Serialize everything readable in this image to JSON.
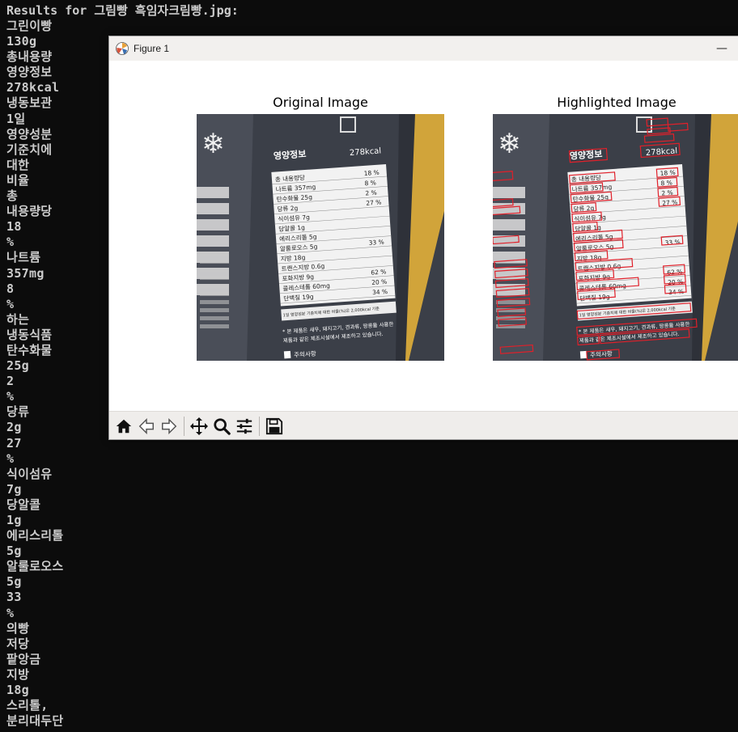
{
  "terminal": {
    "header": "Results for 그림빵 흑임자크림빵.jpg:",
    "lines": [
      "그린이빵",
      "130g",
      "총내용량",
      "영양정보",
      "278kcal",
      "냉동보관",
      "1일",
      "영양성분",
      "기준치에",
      "대한",
      "비율",
      "총",
      "내용량당",
      "18",
      "%",
      "나트륨",
      "357mg",
      "8",
      "%",
      "하는",
      "냉동식품",
      "탄수화물",
      "25g",
      "2",
      "%",
      "당류",
      "2g",
      "27",
      "%",
      "식이섬유",
      "7g",
      "당알콜",
      "1g",
      "에리스리톨",
      "5g",
      "알룰로오스",
      "5g",
      "33",
      "%",
      "의빵",
      "저당",
      "팥앙금",
      "지방",
      "18g",
      "스리톨,",
      "분리대두단"
    ]
  },
  "window": {
    "title": "Figure 1",
    "minimize_glyph": "—"
  },
  "plots": {
    "left_title": "Original Image",
    "right_title": "Highlighted Image"
  },
  "label_photo": {
    "header": "영양정보",
    "total": "278kcal",
    "rows": [
      {
        "name": "총 내용량당",
        "pct": "18 %"
      },
      {
        "name": "나트륨 357mg",
        "pct": "8 %"
      },
      {
        "name": "탄수화물 25g",
        "pct": "2 %"
      },
      {
        "name": "당류 2g",
        "pct": "27 %"
      },
      {
        "name": "식이섬유 7g",
        "pct": ""
      },
      {
        "name": "당알콜 1g",
        "pct": ""
      },
      {
        "name": "에리스리톨 5g",
        "pct": ""
      },
      {
        "name": "알룰로오스 5g",
        "pct": "33 %"
      },
      {
        "name": "지방 18g",
        "pct": ""
      },
      {
        "name": "트랜스지방 0.6g",
        "pct": ""
      },
      {
        "name": "포화지방 9g",
        "pct": "62 %"
      },
      {
        "name": "콜레스테롤 60mg",
        "pct": "20 %"
      },
      {
        "name": "단백질 19g",
        "pct": "34 %"
      }
    ],
    "footnote": "1일 영양성분 기준치에 대한 비율(%)은 2,000kcal 기준",
    "allergy": "* 본 제품은 새우, 돼지고기, 견과류, 땅콩을 사용한",
    "allergy2": "제품과 같은 제조시설에서 제조하고 있습니다.",
    "caution": "주의사항"
  },
  "toolbar": {
    "tools": [
      "home-icon",
      "back-icon",
      "forward-icon",
      "pan-icon",
      "zoom-icon",
      "configure-icon",
      "save-icon"
    ]
  },
  "colors": {
    "terminal_bg": "#0c0c0c",
    "terminal_text": "#cccccc",
    "highlight_box": "#e0202a",
    "label_bg": "#3a3e48",
    "table_bg": "#f2f2f2"
  }
}
